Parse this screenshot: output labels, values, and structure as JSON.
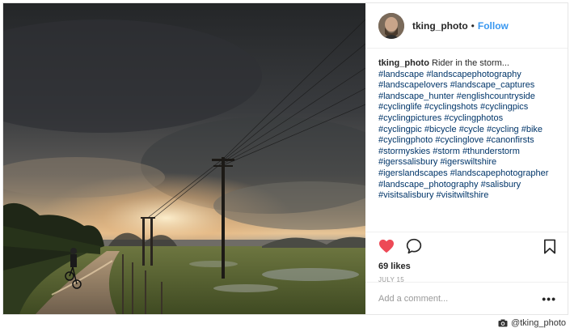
{
  "post": {
    "username": "tking_photo",
    "separator": "•",
    "follow_label": "Follow",
    "caption_user": "tking_photo",
    "caption_text": "Rider in the storm...",
    "hashtags": [
      "#landscape",
      "#landscapephotography",
      "#landscapelovers",
      "#landscape_captures",
      "#landscape_hunter",
      "#englishcountryside",
      "#cyclinglife",
      "#cyclingshots",
      "#cyclingpics",
      "#cyclingpictures",
      "#cyclingphotos",
      "#cyclingpic",
      "#bicycle",
      "#cycle",
      "#cycling",
      "#bike",
      "#cyclingphoto",
      "#cyclinglove",
      "#canonfirsts",
      "#stormyskies",
      "#storm",
      "#thunderstorm",
      "#igerssalisbury",
      "#igerswiltshire",
      "#igerslandscapes",
      "#landscapephotographer",
      "#landscape_photography",
      "#salisbury",
      "#visitsalisbury",
      "#visitwiltshire"
    ],
    "likes": "69 likes",
    "date": "JULY 15",
    "comment_placeholder": "Add a comment...",
    "more_label": "•••",
    "liked": true
  },
  "credit": {
    "text": "@tking_photo",
    "icon": "camera-icon"
  },
  "icons": {
    "like": "heart-icon",
    "comment": "comment-icon",
    "save": "bookmark-icon",
    "more": "more-options-icon"
  },
  "colors": {
    "like_red": "#ed4956",
    "follow_blue": "#3897f0",
    "hashtag_blue": "#003569",
    "muted_gray": "#999999"
  }
}
